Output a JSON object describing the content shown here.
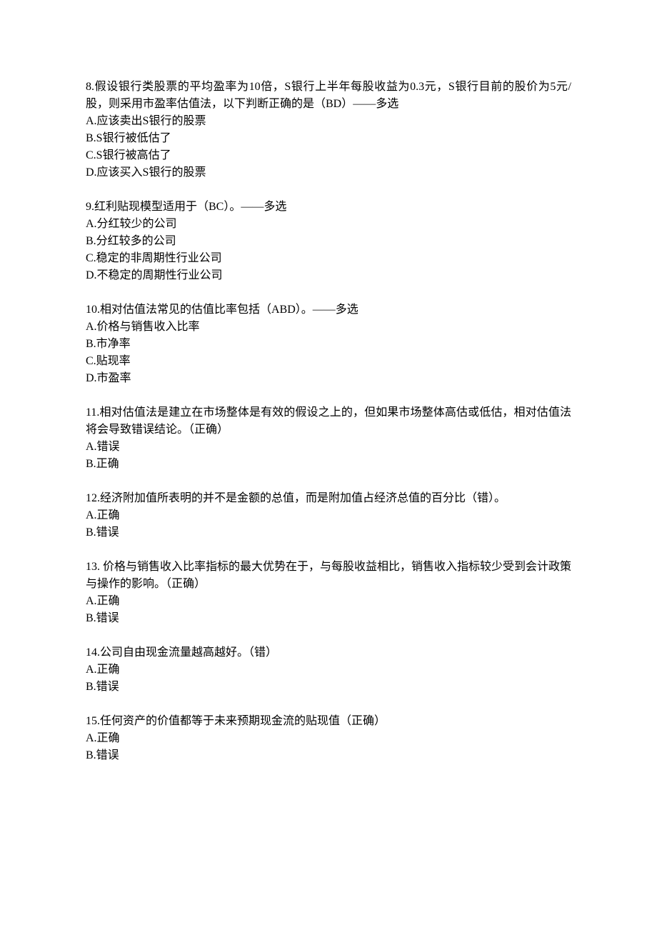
{
  "questions": [
    {
      "num": "8",
      "stem": "8.假设银行类股票的平均盈率为10倍，S银行上半年每股收益为0.3元，S银行目前的股价为5元/股，则采用市盈率估值法，以下判断正确的是（BD）——多选",
      "options": [
        "A.应该卖出S银行的股票",
        "B.S银行被低估了",
        "C.S银行被高估了",
        "D.应该买入S银行的股票"
      ]
    },
    {
      "num": "9",
      "stem": "9.红利贴现模型适用于（BC）。——多选",
      "options": [
        "A.分红较少的公司",
        "B.分红较多的公司",
        "C.稳定的非周期性行业公司",
        "D.不稳定的周期性行业公司"
      ]
    },
    {
      "num": "10",
      "stem": "10.相对估值法常见的估值比率包括（ABD）。——多选",
      "options": [
        "A.价格与销售收入比率",
        "B.市净率",
        "C.贴现率",
        "D.市盈率"
      ]
    },
    {
      "num": "11",
      "stem": "11.相对估值法是建立在市场整体是有效的假设之上的，但如果市场整体高估或低估，相对估值法将会导致错误结论。（正确）",
      "options": [
        "A.错误",
        "B.正确"
      ]
    },
    {
      "num": "12",
      "stem": "12.经济附加值所表明的并不是金额的总值，而是附加值占经济总值的百分比（错）。",
      "options": [
        "A.正确",
        "B.错误"
      ]
    },
    {
      "num": "13",
      "stem": "13. 价格与销售收入比率指标的最大优势在于，与每股收益相比，销售收入指标较少受到会计政策与操作的影响。（正确）",
      "options": [
        "A.正确",
        "B.错误"
      ]
    },
    {
      "num": "14",
      "stem": "14.公司自由现金流量越高越好。（错）",
      "options": [
        "A.正确",
        "B.错误"
      ]
    },
    {
      "num": "15",
      "stem": "15.任何资产的价值都等于未来预期现金流的贴现值（正确）",
      "options": [
        "A.正确",
        "B.错误"
      ]
    }
  ]
}
